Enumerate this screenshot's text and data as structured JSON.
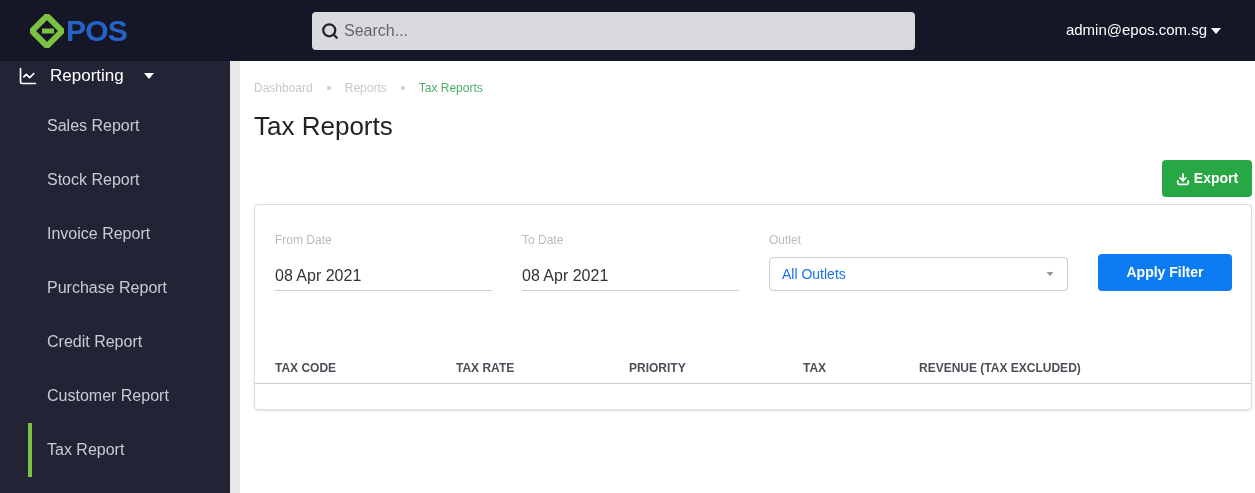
{
  "header": {
    "logo": "POS",
    "search": {
      "placeholder": "Search..."
    },
    "user": "admin@epos.com.sg"
  },
  "sidebar": {
    "section": {
      "label": "Reporting",
      "expanded": true
    },
    "items": [
      {
        "label": "Sales Report",
        "selected": false
      },
      {
        "label": "Stock Report",
        "selected": false
      },
      {
        "label": "Invoice Report",
        "selected": false
      },
      {
        "label": "Purchase Report",
        "selected": false
      },
      {
        "label": "Credit Report",
        "selected": false
      },
      {
        "label": "Customer Report",
        "selected": false
      },
      {
        "label": "Tax Report",
        "selected": true
      }
    ]
  },
  "breadcrumb": [
    "Dashboard",
    "Reports",
    "Tax Reports"
  ],
  "title": "Tax Reports",
  "export_button": "Export",
  "filters": {
    "from": {
      "label": "From Date",
      "value": "08 Apr 2021"
    },
    "to": {
      "label": "To Date",
      "value": "08 Apr 2021"
    },
    "outlet": {
      "label": "Outlet",
      "value": "All Outlets"
    },
    "apply": "Apply Filter"
  },
  "table": {
    "columns": [
      "TAX CODE",
      "TAX RATE",
      "PRIORITY",
      "TAX",
      "REVENUE (TAX EXCLUDED)"
    ]
  }
}
